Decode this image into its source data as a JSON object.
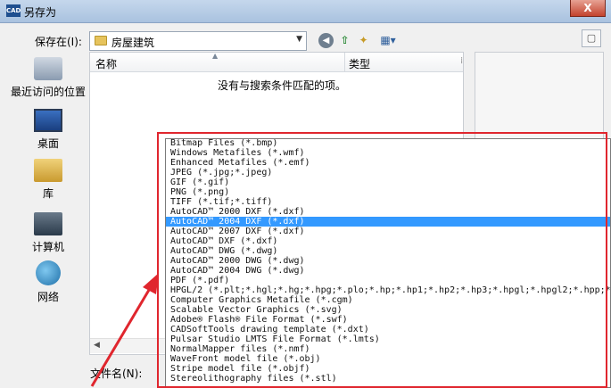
{
  "window": {
    "app_icon": "CAD",
    "title": "另存为",
    "close": "X"
  },
  "toolbar": {
    "save_in_label": "保存在(I):",
    "save_in_value": "房屋建筑",
    "icons": [
      "back-icon",
      "up-folder-icon",
      "new-folder-icon",
      "view-menu-icon"
    ]
  },
  "places": [
    {
      "id": "recent",
      "label": "最近访问的位置",
      "icon": "recent-places-icon"
    },
    {
      "id": "desktop",
      "label": "桌面",
      "icon": "desktop-icon"
    },
    {
      "id": "library",
      "label": "库",
      "icon": "library-icon"
    },
    {
      "id": "computer",
      "label": "计算机",
      "icon": "computer-icon"
    },
    {
      "id": "network",
      "label": "网络",
      "icon": "network-icon"
    }
  ],
  "filelist": {
    "columns": [
      "名称",
      "类型"
    ],
    "empty_message": "没有与搜索条件匹配的项。"
  },
  "filename": {
    "label": "文件名(N):"
  },
  "file_type_options": [
    "Bitmap Files (*.bmp)",
    "Windows Metafiles (*.wmf)",
    "Enhanced Metafiles (*.emf)",
    "JPEG (*.jpg;*.jpeg)",
    "GIF (*.gif)",
    "PNG (*.png)",
    "TIFF (*.tif;*.tiff)",
    "AutoCAD™ 2000 DXF (*.dxf)",
    "AutoCAD™ 2004 DXF (*.dxf)",
    "AutoCAD™ 2007 DXF (*.dxf)",
    "AutoCAD™ DXF (*.dxf)",
    "AutoCAD™ DWG (*.dwg)",
    "AutoCAD™ 2000 DWG (*.dwg)",
    "AutoCAD™ 2004 DWG (*.dwg)",
    "PDF (*.pdf)",
    "HPGL/2 (*.plt;*.hgl;*.hg;*.hpg;*.plo;*.hp;*.hp1;*.hp2;*.hp3;*.hpgl;*.hpgl2;*.hpp;*.gl;*",
    "Computer Graphics Metafile (*.cgm)",
    "Scalable Vector Graphics (*.svg)",
    "Adobe® Flash® File Format (*.swf)",
    "CADSoftTools drawing template (*.dxt)",
    "Pulsar Studio LMTS File Format (*.lmts)",
    "NormalMapper files (*.nmf)",
    "WaveFront model file (*.obj)",
    "Stripe model file (*.objf)",
    "Stereolithography files (*.stl)"
  ],
  "selected_option": "AutoCAD™ 2004 DXF (*.dxf)",
  "colors": {
    "annotation_red": "#e0262e",
    "selection_blue": "#3399ff"
  }
}
